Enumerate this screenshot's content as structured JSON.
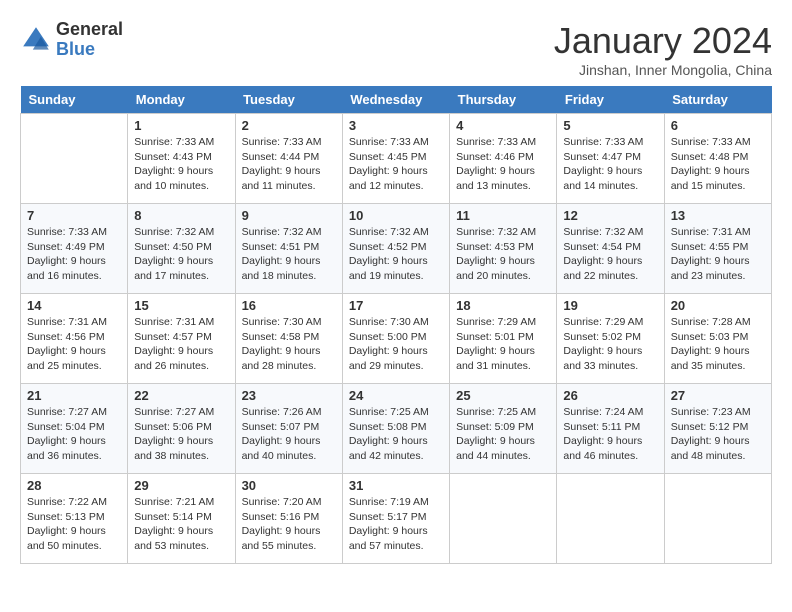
{
  "header": {
    "logo_general": "General",
    "logo_blue": "Blue",
    "month_title": "January 2024",
    "subtitle": "Jinshan, Inner Mongolia, China"
  },
  "days_of_week": [
    "Sunday",
    "Monday",
    "Tuesday",
    "Wednesday",
    "Thursday",
    "Friday",
    "Saturday"
  ],
  "weeks": [
    [
      {
        "num": "",
        "empty": true
      },
      {
        "num": "1",
        "sunrise": "7:33 AM",
        "sunset": "4:43 PM",
        "daylight": "9 hours and 10 minutes."
      },
      {
        "num": "2",
        "sunrise": "7:33 AM",
        "sunset": "4:44 PM",
        "daylight": "9 hours and 11 minutes."
      },
      {
        "num": "3",
        "sunrise": "7:33 AM",
        "sunset": "4:45 PM",
        "daylight": "9 hours and 12 minutes."
      },
      {
        "num": "4",
        "sunrise": "7:33 AM",
        "sunset": "4:46 PM",
        "daylight": "9 hours and 13 minutes."
      },
      {
        "num": "5",
        "sunrise": "7:33 AM",
        "sunset": "4:47 PM",
        "daylight": "9 hours and 14 minutes."
      },
      {
        "num": "6",
        "sunrise": "7:33 AM",
        "sunset": "4:48 PM",
        "daylight": "9 hours and 15 minutes."
      }
    ],
    [
      {
        "num": "7",
        "sunrise": "7:33 AM",
        "sunset": "4:49 PM",
        "daylight": "9 hours and 16 minutes."
      },
      {
        "num": "8",
        "sunrise": "7:32 AM",
        "sunset": "4:50 PM",
        "daylight": "9 hours and 17 minutes."
      },
      {
        "num": "9",
        "sunrise": "7:32 AM",
        "sunset": "4:51 PM",
        "daylight": "9 hours and 18 minutes."
      },
      {
        "num": "10",
        "sunrise": "7:32 AM",
        "sunset": "4:52 PM",
        "daylight": "9 hours and 19 minutes."
      },
      {
        "num": "11",
        "sunrise": "7:32 AM",
        "sunset": "4:53 PM",
        "daylight": "9 hours and 20 minutes."
      },
      {
        "num": "12",
        "sunrise": "7:32 AM",
        "sunset": "4:54 PM",
        "daylight": "9 hours and 22 minutes."
      },
      {
        "num": "13",
        "sunrise": "7:31 AM",
        "sunset": "4:55 PM",
        "daylight": "9 hours and 23 minutes."
      }
    ],
    [
      {
        "num": "14",
        "sunrise": "7:31 AM",
        "sunset": "4:56 PM",
        "daylight": "9 hours and 25 minutes."
      },
      {
        "num": "15",
        "sunrise": "7:31 AM",
        "sunset": "4:57 PM",
        "daylight": "9 hours and 26 minutes."
      },
      {
        "num": "16",
        "sunrise": "7:30 AM",
        "sunset": "4:58 PM",
        "daylight": "9 hours and 28 minutes."
      },
      {
        "num": "17",
        "sunrise": "7:30 AM",
        "sunset": "5:00 PM",
        "daylight": "9 hours and 29 minutes."
      },
      {
        "num": "18",
        "sunrise": "7:29 AM",
        "sunset": "5:01 PM",
        "daylight": "9 hours and 31 minutes."
      },
      {
        "num": "19",
        "sunrise": "7:29 AM",
        "sunset": "5:02 PM",
        "daylight": "9 hours and 33 minutes."
      },
      {
        "num": "20",
        "sunrise": "7:28 AM",
        "sunset": "5:03 PM",
        "daylight": "9 hours and 35 minutes."
      }
    ],
    [
      {
        "num": "21",
        "sunrise": "7:27 AM",
        "sunset": "5:04 PM",
        "daylight": "9 hours and 36 minutes."
      },
      {
        "num": "22",
        "sunrise": "7:27 AM",
        "sunset": "5:06 PM",
        "daylight": "9 hours and 38 minutes."
      },
      {
        "num": "23",
        "sunrise": "7:26 AM",
        "sunset": "5:07 PM",
        "daylight": "9 hours and 40 minutes."
      },
      {
        "num": "24",
        "sunrise": "7:25 AM",
        "sunset": "5:08 PM",
        "daylight": "9 hours and 42 minutes."
      },
      {
        "num": "25",
        "sunrise": "7:25 AM",
        "sunset": "5:09 PM",
        "daylight": "9 hours and 44 minutes."
      },
      {
        "num": "26",
        "sunrise": "7:24 AM",
        "sunset": "5:11 PM",
        "daylight": "9 hours and 46 minutes."
      },
      {
        "num": "27",
        "sunrise": "7:23 AM",
        "sunset": "5:12 PM",
        "daylight": "9 hours and 48 minutes."
      }
    ],
    [
      {
        "num": "28",
        "sunrise": "7:22 AM",
        "sunset": "5:13 PM",
        "daylight": "9 hours and 50 minutes."
      },
      {
        "num": "29",
        "sunrise": "7:21 AM",
        "sunset": "5:14 PM",
        "daylight": "9 hours and 53 minutes."
      },
      {
        "num": "30",
        "sunrise": "7:20 AM",
        "sunset": "5:16 PM",
        "daylight": "9 hours and 55 minutes."
      },
      {
        "num": "31",
        "sunrise": "7:19 AM",
        "sunset": "5:17 PM",
        "daylight": "9 hours and 57 minutes."
      },
      {
        "num": "",
        "empty": true
      },
      {
        "num": "",
        "empty": true
      },
      {
        "num": "",
        "empty": true
      }
    ]
  ],
  "labels": {
    "sunrise_prefix": "Sunrise: ",
    "sunset_prefix": "Sunset: ",
    "daylight_prefix": "Daylight: "
  }
}
